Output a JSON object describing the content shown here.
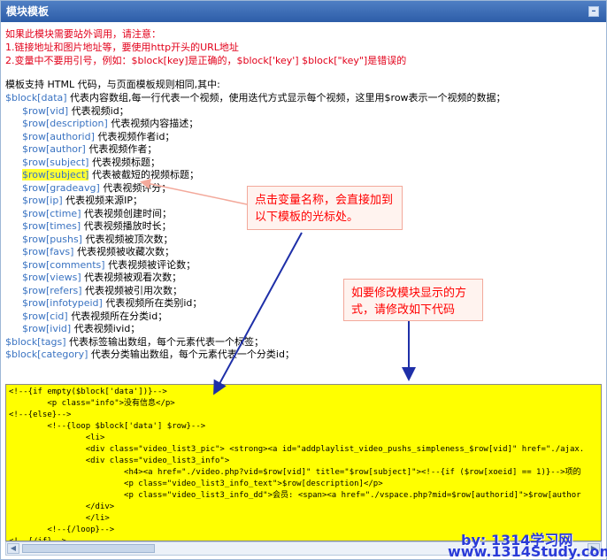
{
  "panel": {
    "title": "模块模板",
    "collapse_symbol": "–"
  },
  "notice": [
    "如果此模块需要站外调用，请注意：",
    "1.链接地址和图片地址等，要使用http开头的URL地址",
    "2.变量中不要用引号，例如：$block[key]是正确的，$block['key'] $block[\"key\"]是错误的"
  ],
  "intro": "模板支持 HTML 代码，与页面模板规则相同,其中:",
  "variables": [
    {
      "name": "$block[data]",
      "desc": "代表内容数组,每一行代表一个视频，使用迭代方式显示每个视频，这里用$row表示一个视频的数据；",
      "indent": false
    },
    {
      "name": "$row[vid]",
      "desc": "代表视频id；",
      "indent": true
    },
    {
      "name": "$row[description]",
      "desc": "代表视频内容描述；",
      "indent": true
    },
    {
      "name": "$row[authorid]",
      "desc": "代表视频作者id；",
      "indent": true
    },
    {
      "name": "$row[author]",
      "desc": "代表视频作者；",
      "indent": true
    },
    {
      "name": "$row[subject]",
      "desc": "代表视频标题；",
      "indent": true
    },
    {
      "name": "$row[subject]",
      "desc": "代表被截短的视频标题；",
      "indent": true,
      "highlight": true
    },
    {
      "name": "$row[gradeavg]",
      "desc": "代表视频评分；",
      "indent": true
    },
    {
      "name": "$row[ip]",
      "desc": "代表视频来源IP；",
      "indent": true
    },
    {
      "name": "$row[ctime]",
      "desc": "代表视频创建时间；",
      "indent": true
    },
    {
      "name": "$row[times]",
      "desc": "代表视频播放时长；",
      "indent": true
    },
    {
      "name": "$row[pushs]",
      "desc": "代表视频被顶次数；",
      "indent": true
    },
    {
      "name": "$row[favs]",
      "desc": "代表视频被收藏次数；",
      "indent": true
    },
    {
      "name": "$row[comments]",
      "desc": "代表视频被评论数；",
      "indent": true
    },
    {
      "name": "$row[views]",
      "desc": "代表视频被观看次数；",
      "indent": true
    },
    {
      "name": "$row[refers]",
      "desc": "代表视频被引用次数；",
      "indent": true
    },
    {
      "name": "$row[infotypeid]",
      "desc": "代表视频所在类别id；",
      "indent": true
    },
    {
      "name": "$row[cid]",
      "desc": "代表视频所在分类id；",
      "indent": true
    },
    {
      "name": "$row[ivid]",
      "desc": "代表视频ivid；",
      "indent": true
    },
    {
      "name": "$block[tags]",
      "desc": "代表标签输出数组，每个元素代表一个标签；",
      "indent": false
    },
    {
      "name": "$block[category]",
      "desc": "代表分类输出数组，每个元素代表一个分类id；",
      "indent": false
    }
  ],
  "callout_click": "点击变量名称，会直接加到\n以下模板的光标处。",
  "callout_modify": "如要修改模块显示的方\n式，请修改如下代码",
  "code": "<!--{if empty($block['data'])}-->\n        <p class=\"info\">没有信息</p>\n<!--{else}-->\n        <!--{loop $block['data'] $row}-->\n                <li>\n                <div class=\"video_list3_pic\"> <strong><a id=\"addplaylist_video_pushs_simpleness_$row[vid]\" href=\"./ajax.\n                <div class=\"video_list3_info\">\n                        <h4><a href=\"./video.php?vid=$row[vid]\" title=\"$row[subject]\"><!--{if ($row[xoeid] == 1)}-->项的\n                        <p class=\"video_list3_info_text\">$row[description]</p>\n                        <p class=\"video_list3_info_dd\">会员: <span><a href=\"./vspace.php?mid=$row[authorid]\">$row[author\n                </div>\n                </li>\n        <!--{/loop}-->\n<!--{/if}-->",
  "watermark": {
    "by": "by: 1314学习网",
    "url": "www.1314Study.com"
  },
  "colors": {
    "titlebar": "#2d5da8",
    "notice": "#e2001a",
    "variable": "#3a73c2",
    "code_bg": "#ffff00",
    "callout_text": "#ff0000",
    "watermark": "#2a3bd8"
  }
}
